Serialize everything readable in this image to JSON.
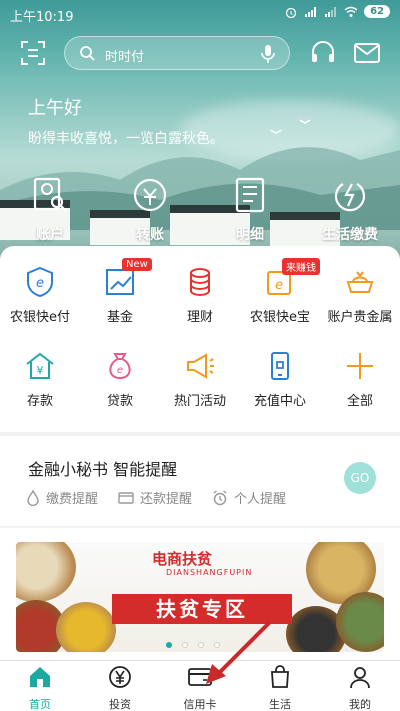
{
  "status_bar": {
    "time": "上午10:19",
    "battery": "62"
  },
  "search": {
    "placeholder": "时时付"
  },
  "greeting": {
    "title": "上午好",
    "subtitle": "盼得丰收喜悦，一览白露秋色。"
  },
  "quick_actions": [
    {
      "label": "账户",
      "icon": "account-search-icon"
    },
    {
      "label": "转账",
      "icon": "transfer-icon"
    },
    {
      "label": "明细",
      "icon": "details-icon"
    },
    {
      "label": "生活缴费",
      "icon": "bill-pay-icon"
    }
  ],
  "services": [
    {
      "label": "农银快e付",
      "icon": "e-pay-icon"
    },
    {
      "label": "基金",
      "icon": "fund-chart-icon",
      "badge": "New"
    },
    {
      "label": "理财",
      "icon": "coins-stack-icon"
    },
    {
      "label": "农银快e宝",
      "icon": "e-bao-icon",
      "badge": "来赚钱"
    },
    {
      "label": "账户贵金属",
      "icon": "gold-ingot-icon"
    },
    {
      "label": "存款",
      "icon": "deposit-house-icon"
    },
    {
      "label": "贷款",
      "icon": "loan-bag-icon"
    },
    {
      "label": "热门活动",
      "icon": "megaphone-icon"
    },
    {
      "label": "充值中心",
      "icon": "phone-recharge-icon"
    },
    {
      "label": "全部",
      "icon": "plus-icon"
    }
  ],
  "assistant": {
    "title": "金融小秘书 智能提醒",
    "items": [
      {
        "label": "缴费提醒",
        "icon": "drop-icon"
      },
      {
        "label": "还款提醒",
        "icon": "card-icon"
      },
      {
        "label": "个人提醒",
        "icon": "alarm-clock-icon"
      }
    ],
    "go_label": "GO"
  },
  "banner": {
    "logo_text": "电商扶贫",
    "logo_sub": "DIANSHANGFUPIN",
    "title": "扶贫专区",
    "page_count": 4,
    "active_index": 0
  },
  "bottom_nav": [
    {
      "label": "首页",
      "icon": "home-icon",
      "active": true
    },
    {
      "label": "投资",
      "icon": "yen-circle-icon",
      "active": false
    },
    {
      "label": "信用卡",
      "icon": "credit-card-icon",
      "active": false
    },
    {
      "label": "生活",
      "icon": "shopping-bag-icon",
      "active": false
    },
    {
      "label": "我的",
      "icon": "user-icon",
      "active": false
    }
  ],
  "colors": {
    "accent": "#1ba9a0",
    "badge_red": "#e9322e",
    "fund_blue": "#2d7fd3",
    "orange": "#f39a1e"
  }
}
